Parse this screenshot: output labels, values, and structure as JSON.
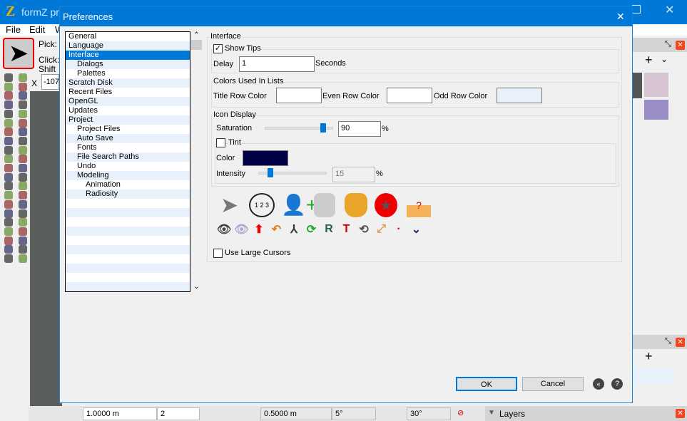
{
  "app": {
    "title": "formZ pr",
    "menu": [
      "File",
      "Edit",
      "W"
    ],
    "pick_label": "Pick:",
    "click_label": "Click:",
    "shift_label": "Shift",
    "x_label": "X",
    "x_value": "-107"
  },
  "dialog": {
    "title": "Preferences",
    "close": "✕",
    "tree": [
      {
        "label": "General",
        "level": 0
      },
      {
        "label": "Language",
        "level": 0
      },
      {
        "label": "Interface",
        "level": 0,
        "selected": true
      },
      {
        "label": "Dialogs",
        "level": 1
      },
      {
        "label": "Palettes",
        "level": 1
      },
      {
        "label": "Scratch Disk",
        "level": 0
      },
      {
        "label": "Recent Files",
        "level": 0
      },
      {
        "label": "OpenGL",
        "level": 0
      },
      {
        "label": "Updates",
        "level": 0
      },
      {
        "label": "Project",
        "level": 0
      },
      {
        "label": "Project Files",
        "level": 1
      },
      {
        "label": "Auto Save",
        "level": 1
      },
      {
        "label": "Fonts",
        "level": 1
      },
      {
        "label": "File Search Paths",
        "level": 1
      },
      {
        "label": "Undo",
        "level": 1
      },
      {
        "label": "Modeling",
        "level": 1
      },
      {
        "label": "Animation",
        "level": 2
      },
      {
        "label": "Radiosity",
        "level": 2
      }
    ],
    "interface": {
      "heading": "Interface",
      "show_tips": {
        "label": "Show Tips",
        "checked": true
      },
      "delay_label": "Delay",
      "delay_value": "1",
      "seconds_label": "Seconds"
    },
    "colors": {
      "heading": "Colors Used In Lists",
      "title_row": "Title Row Color",
      "even_row": "Even Row Color",
      "odd_row": "Odd Row Color",
      "title_color": "#ffffff",
      "even_color": "#ffffff",
      "odd_color": "#e8f1fb"
    },
    "icon_display": {
      "heading": "Icon Display",
      "saturation_label": "Saturation",
      "saturation_value": "90",
      "percent": "%",
      "tint": {
        "label": "Tint",
        "checked": false
      },
      "color_label": "Color",
      "tint_color": "#000046",
      "intensity_label": "Intensity",
      "intensity_value": "15"
    },
    "large_cursors": {
      "label": "Use Large Cursors",
      "checked": false
    },
    "ok": "OK",
    "cancel": "Cancel"
  },
  "status": {
    "grid": "1.0000 m",
    "count": "2",
    "snap": "0.5000 m",
    "angle1": "5°",
    "angle2": "30°",
    "layers": "Layers"
  },
  "accent": "#0078d7"
}
